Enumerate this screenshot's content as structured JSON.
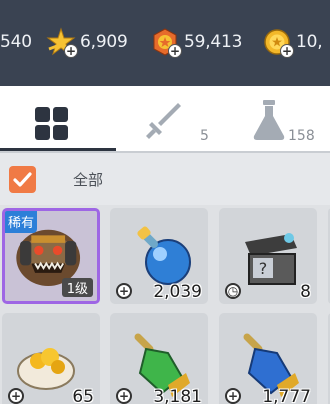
{
  "currency": [
    {
      "icon": "currency-icon",
      "value": "540"
    },
    {
      "icon": "star-icon",
      "value": "6,909"
    },
    {
      "icon": "medal-icon",
      "value": "59,413"
    },
    {
      "icon": "gold-coin-icon",
      "value": "10,"
    }
  ],
  "tabs": {
    "grid_icon": "grid-icon",
    "weapon_icon": "sword-icon",
    "weapon_count": "5",
    "potion_icon": "flask-icon",
    "potion_count": "158"
  },
  "filter": {
    "checked": true,
    "label": "全部"
  },
  "items": [
    {
      "icon": "monster-icon",
      "rare": "稀有",
      "level": "1级",
      "quantity": ""
    },
    {
      "icon": "blue-potion-icon",
      "badge": "+",
      "quantity": "2,039"
    },
    {
      "icon": "mystery-chest-icon",
      "badge": "clock",
      "quantity": "8"
    },
    {
      "icon": "gold-ore-icon",
      "badge": "+",
      "quantity": "65"
    },
    {
      "icon": "green-potion-icon",
      "badge": "+",
      "quantity": "3,181"
    },
    {
      "icon": "blue-gold-potion-icon",
      "badge": "+",
      "quantity": "1,777"
    }
  ],
  "colors": {
    "topbar": "#3a4352",
    "accent_orange": "#f07a45",
    "rare_border": "#9e66e4",
    "rare_tag": "#2c7fd8"
  }
}
